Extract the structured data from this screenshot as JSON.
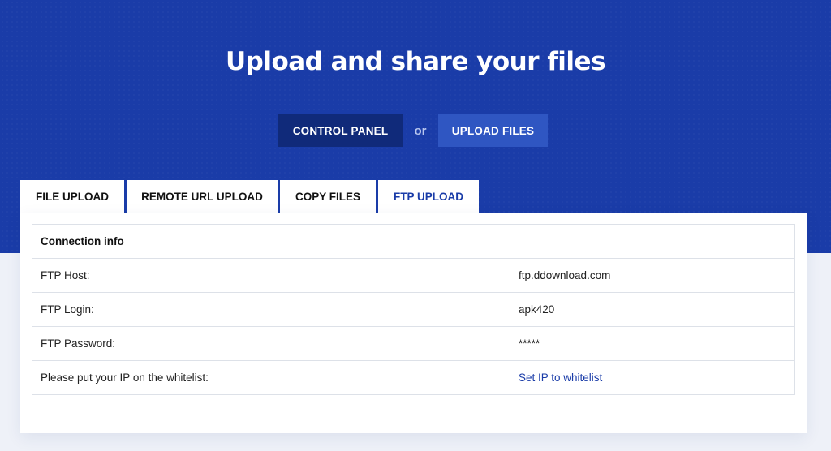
{
  "hero": {
    "title": "Upload and share your files",
    "control_panel_label": "CONTROL PANEL",
    "or_label": "or",
    "upload_files_label": "UPLOAD FILES"
  },
  "tabs": [
    {
      "label": "FILE UPLOAD",
      "active": false
    },
    {
      "label": "REMOTE URL UPLOAD",
      "active": false
    },
    {
      "label": "COPY FILES",
      "active": false
    },
    {
      "label": "FTP UPLOAD",
      "active": true
    }
  ],
  "connection": {
    "header": "Connection info",
    "rows": [
      {
        "label": "FTP Host:",
        "value": "ftp.ddownload.com"
      },
      {
        "label": "FTP Login:",
        "value": "apk420"
      },
      {
        "label": "FTP Password:",
        "value": "*****"
      },
      {
        "label": "Please put your IP on the whitelist:",
        "value": "Set IP to whitelist"
      }
    ]
  },
  "colors": {
    "hero_background": "#1a3ca8",
    "control_panel_button": "#102a7a",
    "upload_files_button": "#2f56c2",
    "active_tab_text": "#1a3ca8",
    "link": "#1a3ca8"
  }
}
